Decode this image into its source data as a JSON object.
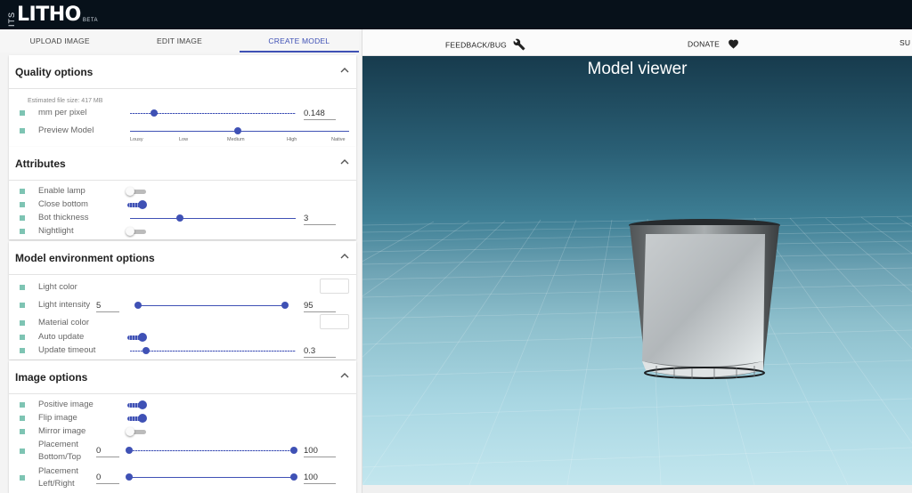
{
  "app": {
    "logo_prefix": "ITS",
    "logo_main": "LITHO",
    "logo_tag": "BETA"
  },
  "tabs": [
    {
      "label": "UPLOAD IMAGE"
    },
    {
      "label": "EDIT IMAGE"
    },
    {
      "label": "CREATE MODEL"
    }
  ],
  "active_tab": "CREATE MODEL",
  "nav": {
    "feedback": "FEEDBACK/BUG",
    "donate": "DONATE",
    "cut_off": "SU"
  },
  "viewer": {
    "title": "Model viewer"
  },
  "quality": {
    "title": "Quality options",
    "file_size": "Estimated file size: 417 MB",
    "mm_per_pixel_label": "mm per pixel",
    "mm_per_pixel_value": "0.148",
    "preview_label": "Preview Model",
    "preview_ticks": [
      "Lousy",
      "Low",
      "Medium",
      "High",
      "Native"
    ],
    "preview_selected": "Medium"
  },
  "attributes": {
    "title": "Attributes",
    "enable_lamp": "Enable lamp",
    "close_bottom": "Close bottom",
    "bot_thickness": "Bot thickness",
    "bot_thickness_value": "3",
    "nightlight": "Nightlight",
    "enable_lamp_on": false,
    "close_bottom_on": true,
    "nightlight_on": false
  },
  "environment": {
    "title": "Model environment options",
    "light_color": "Light color",
    "light_intensity": "Light intensity",
    "light_min": "5",
    "light_max": "95",
    "material_color": "Material color",
    "auto_update": "Auto update",
    "update_timeout": "Update timeout",
    "update_timeout_value": "0.3",
    "light_color_hex": "#ffffff",
    "material_color_hex": "#ffffff",
    "auto_update_on": true
  },
  "image": {
    "title": "Image options",
    "positive": "Positive image",
    "flip": "Flip image",
    "mirror": "Mirror image",
    "placement_bt": "Placement\nBottom/Top",
    "placement_bt_min": "0",
    "placement_bt_max": "100",
    "placement_lr": "Placement\nLeft/Right",
    "placement_lr_min": "0",
    "placement_lr_max": "100",
    "positive_on": true,
    "flip_on": true,
    "mirror_on": false
  },
  "colors": {
    "accent": "#3f51b5",
    "marker": "#7ec4b3",
    "topbar": "#07111a"
  },
  "icons": {
    "wrench": "wrench-icon",
    "heart": "heart-icon",
    "collapse": "chevron-up-icon"
  }
}
